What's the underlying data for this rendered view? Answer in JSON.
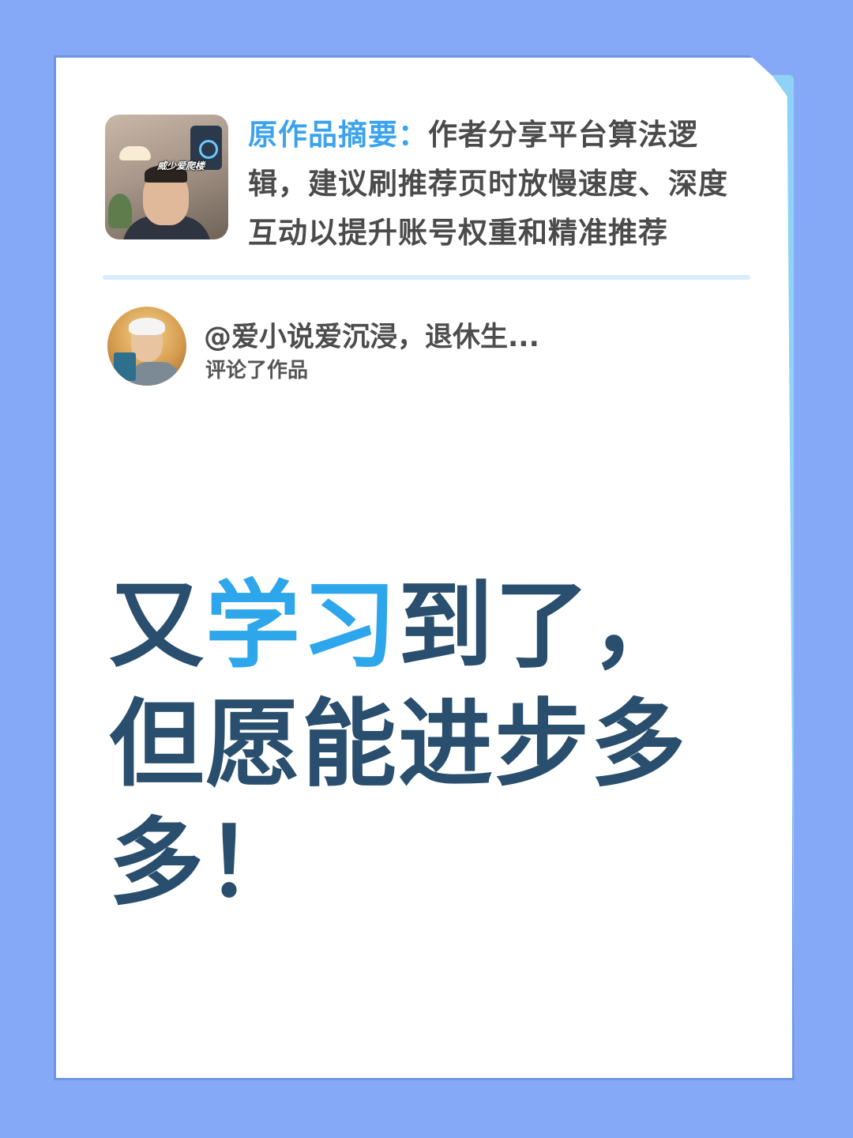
{
  "original_work": {
    "summary_label": "原作品摘要：",
    "summary_text": "作者分享平台算法逻辑，建议刷推荐页时放慢速度、深度互动以提升账号权重和精准推荐",
    "thumbnail_caption": "威少爱爬楼"
  },
  "comment": {
    "username": "@爱小说爱沉浸，退休生...",
    "action": "评论了作品"
  },
  "headline": {
    "part1": "又",
    "highlight": "学习",
    "part2": "到了，但愿能进步多多！"
  },
  "colors": {
    "background": "#85a9f7",
    "accent": "#3ba3ee",
    "headline": "#2a4f6e"
  }
}
